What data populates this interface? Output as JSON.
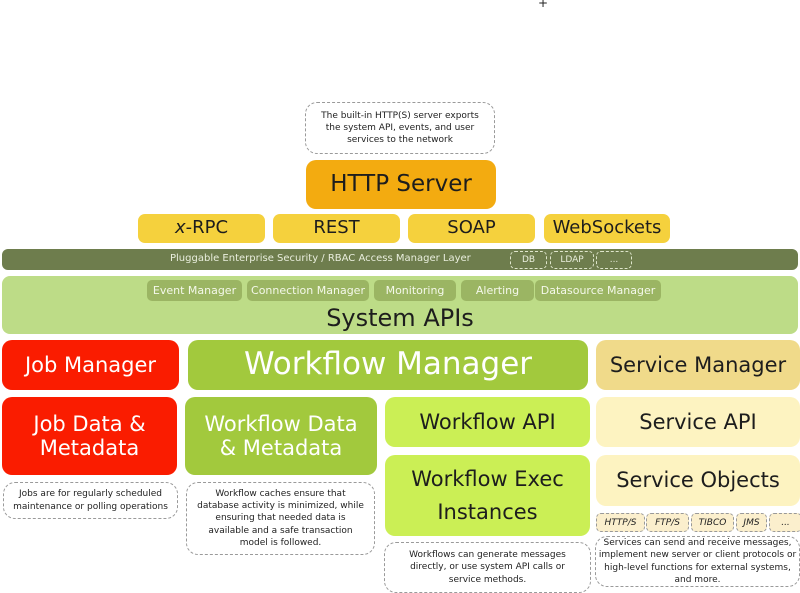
{
  "cursor_glyph": "+",
  "http": {
    "note": "The built-in HTTP(S) server exports the system API, events, and user services to the network",
    "title": "HTTP Server"
  },
  "protocols": [
    {
      "prefix": "x",
      "label": "-RPC"
    },
    {
      "label": "REST"
    },
    {
      "label": "SOAP"
    },
    {
      "label": "WebSockets"
    }
  ],
  "security": {
    "label": "Pluggable Enterprise Security / RBAC Access Manager Layer",
    "plugins": [
      "DB",
      "LDAP",
      "..."
    ]
  },
  "system_apis": {
    "title": "System APIs",
    "modules": [
      "Event Manager",
      "Connection Manager",
      "Monitoring",
      "Alerting",
      "Datasource Manager"
    ]
  },
  "job": {
    "manager": "Job Manager",
    "data": "Job Data & Metadata",
    "note": "Jobs are for regularly scheduled maintenance or polling operations"
  },
  "workflow": {
    "manager": "Workflow Manager",
    "data": "Workflow Data & Metadata",
    "data_note": "Workflow caches ensure that database activity is minimized, while ensuring that needed data is available and a safe transaction model is followed.",
    "api": "Workflow API",
    "exec": "Workflow Exec Instances",
    "exec_note": "Workflows can generate messages directly, or use system API calls or service methods."
  },
  "service": {
    "manager": "Service Manager",
    "api": "Service API",
    "objects": "Service Objects",
    "transports": [
      "HTTP/S",
      "FTP/S",
      "TIBCO",
      "JMS",
      "..."
    ],
    "note": "Services can send and receive messages, implement new server or client protocols or high-level functions for external systems, and more."
  },
  "colors": {
    "http_server": "#f3ab10",
    "protocol": "#f5d13d",
    "security_layer": "#6e7d4d",
    "system_apis": "#bddc87",
    "system_module": "#9bb563",
    "job": "#fa1c00",
    "workflow_manager": "#a2c93d",
    "workflow_api": "#cbef55",
    "service_manager": "#f0da8a",
    "service_api": "#fdf3c1"
  }
}
